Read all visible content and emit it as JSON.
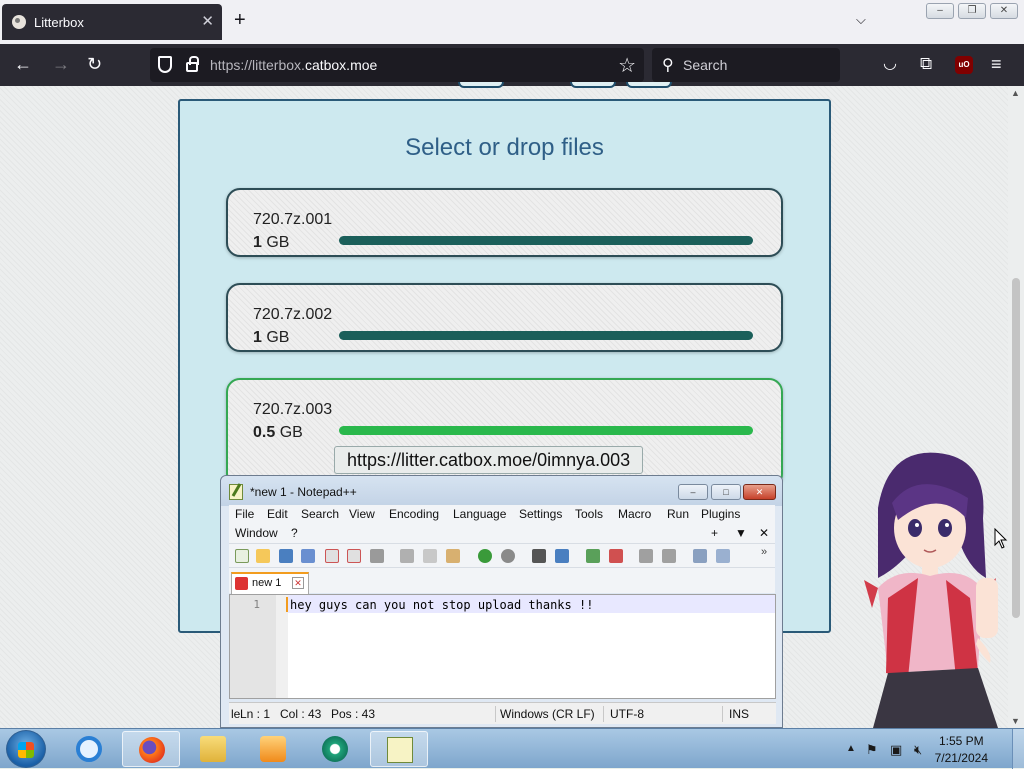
{
  "browser": {
    "tab_title": "Litterbox",
    "tab_close": "✕",
    "new_tab": "+",
    "tab_list": "⌵",
    "url_prefix": "https://litterbox.",
    "url_domain": "catbox.moe",
    "search_placeholder": "Search",
    "window_buttons": [
      "–",
      "❐",
      "✕"
    ]
  },
  "page": {
    "drop_title": "Select or drop files",
    "files": [
      {
        "name": "720.7z.001",
        "size_value": "1",
        "size_unit": "GB",
        "progress": 1.0,
        "status": "uploading"
      },
      {
        "name": "720.7z.002",
        "size_value": "1",
        "size_unit": "GB",
        "progress": 1.0,
        "status": "uploading"
      },
      {
        "name": "720.7z.003",
        "size_value": "0.5",
        "size_unit": "GB",
        "progress": 1.0,
        "status": "done",
        "link": "https://litter.catbox.moe/0imnya.003"
      }
    ]
  },
  "notepad": {
    "title": "*new 1 - Notepad++",
    "menu": [
      "File",
      "Edit",
      "Search",
      "View",
      "Encoding",
      "Language",
      "Settings",
      "Tools",
      "Macro",
      "Run",
      "Plugins",
      "Window",
      "?"
    ],
    "menu_extra": [
      "+",
      "▼",
      "✕"
    ],
    "tab_label": "new 1",
    "line_number": "1",
    "content": "hey guys can you not stop upload thanks !!",
    "status": {
      "prefix": "le",
      "line": "Ln : 1",
      "col": "Col : 43",
      "pos": "Pos : 43",
      "eol": "Windows (CR LF)",
      "encoding": "UTF-8",
      "mode": "INS"
    }
  },
  "taskbar": {
    "time": "1:55 PM",
    "date": "7/21/2024",
    "apps": [
      "internet-explorer",
      "firefox",
      "file-explorer",
      "media-player",
      "chat-app",
      "notepad-plus-plus"
    ]
  },
  "colors": {
    "dropzone_bg": "#cde9ef",
    "progress_uploading": "#1b5f5a",
    "progress_done": "#2ab84c",
    "firefox_dark": "#2b2a33"
  }
}
